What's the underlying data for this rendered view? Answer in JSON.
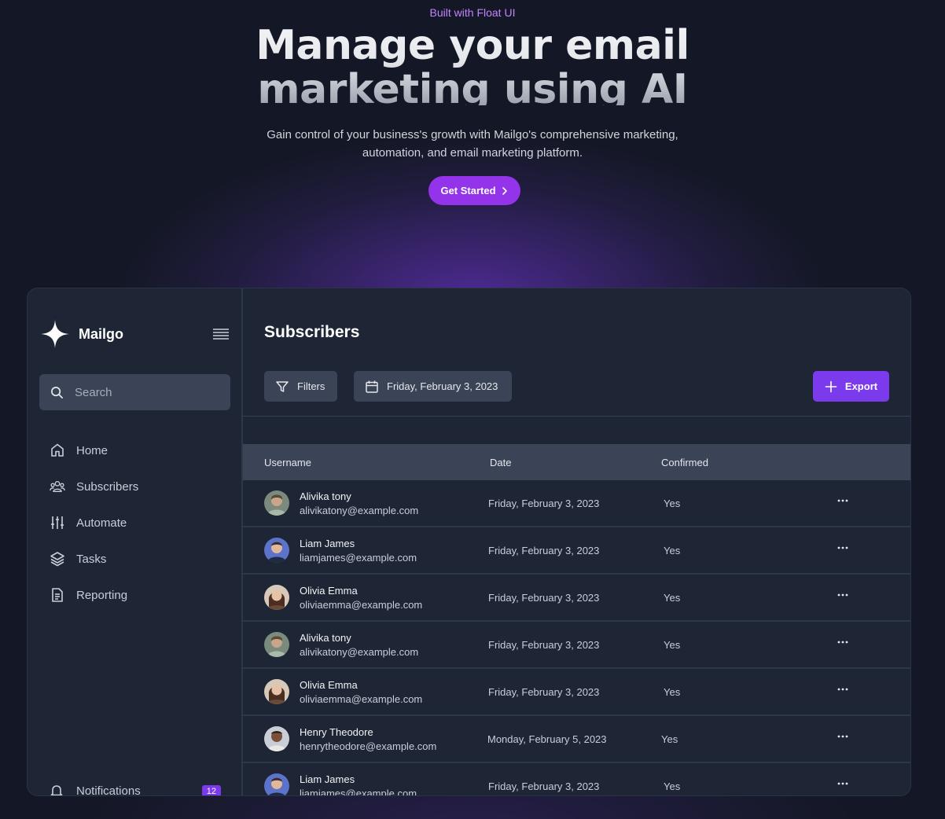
{
  "hero": {
    "eyebrow": "Built with Float UI",
    "headline_line1": "Manage your email",
    "headline_line2": "marketing using AI",
    "subtitle_line1": "Gain control of your business's growth with Mailgo's comprehensive marketing,",
    "subtitle_line2": "automation, and email marketing platform.",
    "cta_label": "Get Started"
  },
  "sidebar": {
    "brand": "Mailgo",
    "search_placeholder": "Search",
    "items": [
      {
        "label": "Home",
        "icon": "home-icon"
      },
      {
        "label": "Subscribers",
        "icon": "users-icon"
      },
      {
        "label": "Automate",
        "icon": "sliders-icon"
      },
      {
        "label": "Tasks",
        "icon": "layers-icon"
      },
      {
        "label": "Reporting",
        "icon": "document-icon"
      }
    ],
    "notifications_label": "Notifications",
    "notifications_count": "12"
  },
  "main": {
    "title": "Subscribers",
    "filters_label": "Filters",
    "date_label": "Friday, February 3, 2023",
    "export_label": "Export",
    "columns": [
      "Username",
      "Date",
      "Confirmed"
    ],
    "rows": [
      {
        "name": "Alivika tony",
        "email": "alivikatony@example.com",
        "date": "Friday, February 3, 2023",
        "confirmed": "Yes"
      },
      {
        "name": "Liam James",
        "email": "liamjames@example.com",
        "date": "Friday, February 3, 2023",
        "confirmed": "Yes"
      },
      {
        "name": "Olivia Emma",
        "email": "oliviaemma@example.com",
        "date": "Friday, February 3, 2023",
        "confirmed": "Yes"
      },
      {
        "name": "Alivika tony",
        "email": "alivikatony@example.com",
        "date": "Friday, February 3, 2023",
        "confirmed": "Yes"
      },
      {
        "name": "Olivia Emma",
        "email": "oliviaemma@example.com",
        "date": "Friday, February 3, 2023",
        "confirmed": "Yes"
      },
      {
        "name": "Henry Theodore",
        "email": "henrytheodore@example.com",
        "date": "Monday, February 5, 2023",
        "confirmed": "Yes"
      },
      {
        "name": "Liam James",
        "email": "liamjames@example.com",
        "date": "Friday, February 3, 2023",
        "confirmed": "Yes"
      }
    ]
  },
  "colors": {
    "accent": "#7c3aed",
    "cta": "#9333ea",
    "eyebrow": "#c084fc",
    "panel": "#1e2534",
    "page_background": "#141826"
  }
}
